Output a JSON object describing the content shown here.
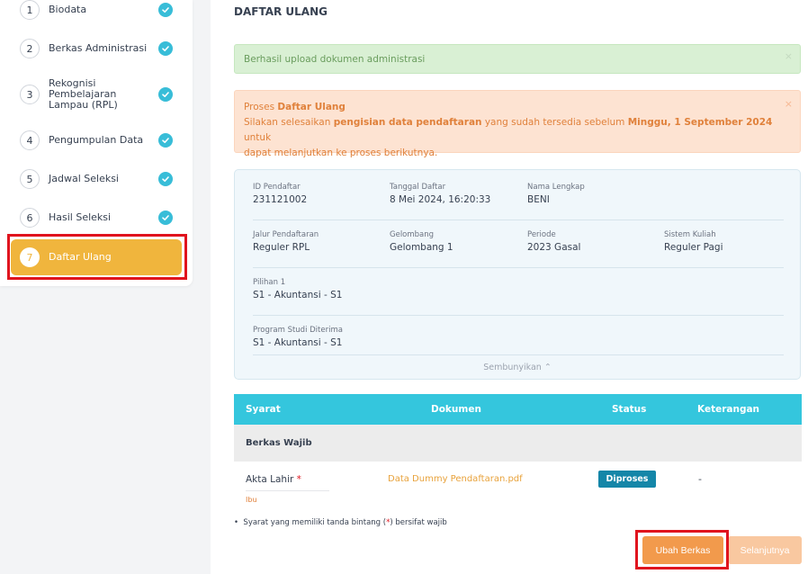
{
  "sidebar": {
    "steps": [
      {
        "num": "1",
        "label": "Biodata"
      },
      {
        "num": "2",
        "label": "Berkas Administrasi"
      },
      {
        "num": "3",
        "label": "Rekognisi Pembelajaran Lampau (RPL)"
      },
      {
        "num": "4",
        "label": "Pengumpulan Data"
      },
      {
        "num": "5",
        "label": "Jadwal Seleksi"
      },
      {
        "num": "6",
        "label": "Hasil Seleksi"
      },
      {
        "num": "7",
        "label": "Daftar Ulang"
      }
    ]
  },
  "main": {
    "title": "DAFTAR ULANG",
    "alert_success": "Berhasil upload dokumen administrasi",
    "alert_close": "×",
    "alert_warn": {
      "prefix": "Proses ",
      "bold_title": "Daftar Ulang",
      "line2_a": "Silakan selesaikan ",
      "line2_b": "pengisian data pendaftaran",
      "line2_c": " yang sudah tersedia sebelum ",
      "line2_d": "Minggu, 1 September 2024",
      "line2_e": " untuk",
      "line3": "dapat melanjutkan ke proses berikutnya."
    },
    "info": {
      "id_label": "ID Pendaftar",
      "id_value": "231121002",
      "tgl_label": "Tanggal Daftar",
      "tgl_value": "8 Mei 2024, 16:20:33",
      "nama_label": "Nama Lengkap",
      "nama_value": "BENI",
      "jalur_label": "Jalur Pendaftaran",
      "jalur_value": "Reguler RPL",
      "gel_label": "Gelombang",
      "gel_value": "Gelombang 1",
      "periode_label": "Periode",
      "periode_value": "2023 Gasal",
      "sistem_label": "Sistem Kuliah",
      "sistem_value": "Reguler Pagi",
      "pilihan_label": "Pilihan 1",
      "pilihan_value": "S1 - Akuntansi - S1",
      "prodi_label": "Program Studi Diterima",
      "prodi_value": "S1 - Akuntansi - S1",
      "toggle": "Sembunyikan ⌃"
    },
    "table": {
      "headers": [
        "Syarat",
        "Dokumen",
        "Status",
        "Keterangan"
      ],
      "group": "Berkas Wajib",
      "row": {
        "syarat": "Akta Lahir",
        "required_mark": "*",
        "sub": "Ibu",
        "dokumen": "Data Dummy Pendaftaran.pdf",
        "status": "Diproses",
        "keterangan": "-"
      }
    },
    "note_a": "Syarat yang memiliki tanda bintang (",
    "note_star": "*",
    "note_b": ") bersifat wajib",
    "btn_ubah": "Ubah Berkas",
    "btn_next": "Selanjutnya"
  },
  "colors": {
    "accent_active": "#f0b53d",
    "check": "#38bdd8",
    "table_header": "#34c6dd",
    "badge": "#1486a8",
    "button_primary": "#f29a4c",
    "highlight": "#e0141e"
  }
}
